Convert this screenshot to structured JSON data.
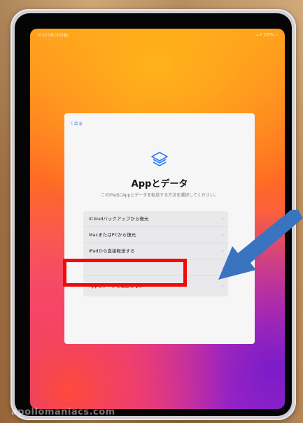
{
  "status_bar": {
    "time": "10:10 9月16日(金)",
    "indicators": "100%"
  },
  "nav": {
    "back_label": "戻る"
  },
  "page": {
    "title": "Appとデータ",
    "subtitle": "このiPadにAppとデータを転送する方法を選択してください。"
  },
  "options": [
    {
      "label": "iCloudバックアップから復元",
      "chevron": "›"
    },
    {
      "label": "MacまたはPCから復元",
      "chevron": "›"
    },
    {
      "label": "iPadから直接転送する",
      "chevron": "›"
    },
    {
      "label": "",
      "chevron": "›"
    },
    {
      "label": "Appとデータを転送しない",
      "chevron": "›"
    }
  ],
  "annotations": {
    "highlight_color": "#f20a0a",
    "arrow_color": "#3a74c0"
  },
  "watermark": "apollomaniacs.com"
}
